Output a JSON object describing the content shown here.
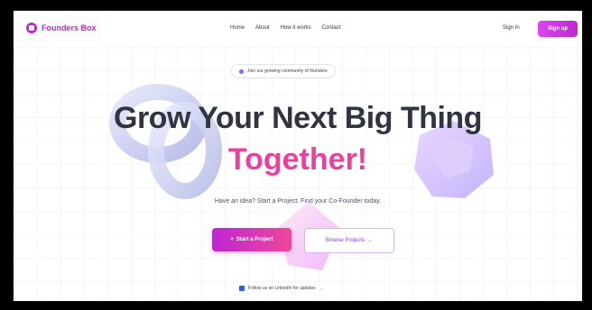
{
  "nav": {
    "brand": "Founders Box",
    "links": [
      "Home",
      "About",
      "How it works",
      "Contact"
    ],
    "signin": "Sign In",
    "signup": "Sign up"
  },
  "hero": {
    "pill": "Join our growing community of founders",
    "title_line1": "Grow Your Next Big Thing",
    "title_line2": "Together!",
    "subtitle": "Have an idea? Start a Project. Find your Co-Founder today.",
    "primary_cta": "Start a Project",
    "secondary_cta": "Browse Projects",
    "follow": "Follow us on LinkedIn for updates"
  },
  "colors": {
    "brand": "#c026d3",
    "heading": "#2f3440",
    "accent_pink": "#ec3fa2"
  }
}
